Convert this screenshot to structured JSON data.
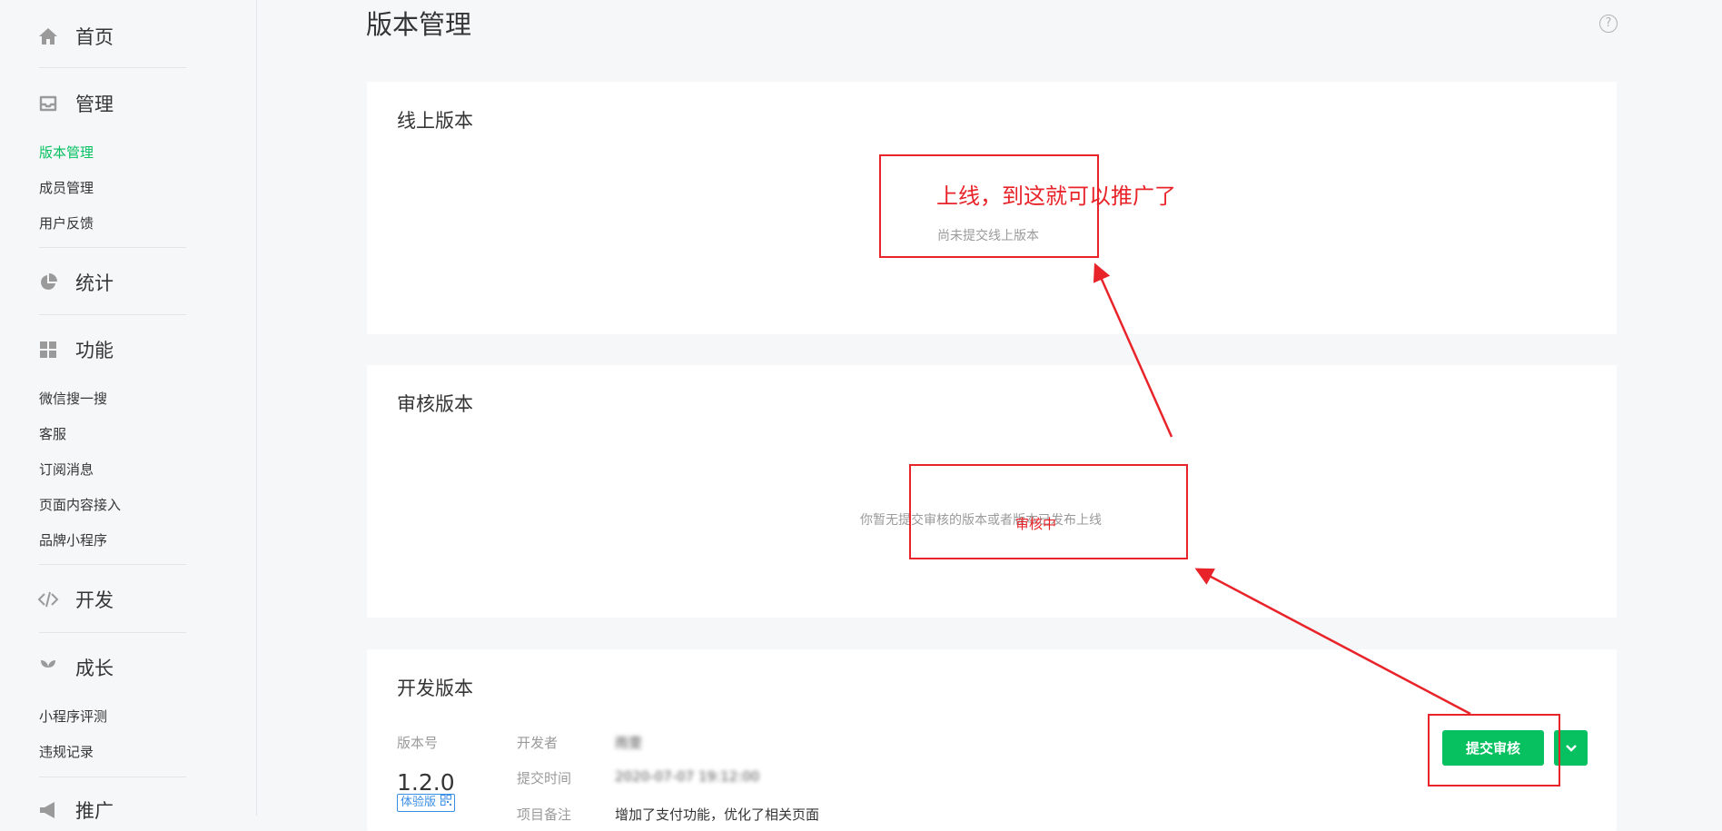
{
  "sidebar": {
    "sections": [
      {
        "label": "首页",
        "icon": "home-icon",
        "items": []
      },
      {
        "label": "管理",
        "icon": "inbox-icon",
        "items": [
          "版本管理",
          "成员管理",
          "用户反馈"
        ]
      },
      {
        "label": "统计",
        "icon": "pie-chart-icon",
        "items": []
      },
      {
        "label": "功能",
        "icon": "grid-icon",
        "items": [
          "微信搜一搜",
          "客服",
          "订阅消息",
          "页面内容接入",
          "品牌小程序"
        ]
      },
      {
        "label": "开发",
        "icon": "code-icon",
        "items": []
      },
      {
        "label": "成长",
        "icon": "sprout-icon",
        "items": [
          "小程序评测",
          "违规记录"
        ]
      },
      {
        "label": "推广",
        "icon": "megaphone-icon",
        "items": []
      }
    ],
    "active_item": "版本管理"
  },
  "page": {
    "title": "版本管理",
    "help_label": "?"
  },
  "online": {
    "title": "线上版本",
    "empty": "尚未提交线上版本"
  },
  "review": {
    "title": "审核版本",
    "empty": "你暂无提交审核的版本或者版本已发布上线"
  },
  "dev": {
    "title": "开发版本",
    "version_label": "版本号",
    "version": "1.2.0",
    "tag": "体验版",
    "developer_label": "开发者",
    "developer": "雨雯",
    "time_label": "提交时间",
    "time": "2020-07-07 19:12:00",
    "note_label": "项目备注",
    "note": "增加了支付功能，优化了相关页面",
    "submit_label": "提交审核"
  },
  "annotations": {
    "online_note": "上线，到这就可以推广了",
    "review_note": "审核中"
  },
  "colors": {
    "accent": "#07c160",
    "annotation": "#e8242a",
    "tag_blue": "#3a8ee6"
  }
}
